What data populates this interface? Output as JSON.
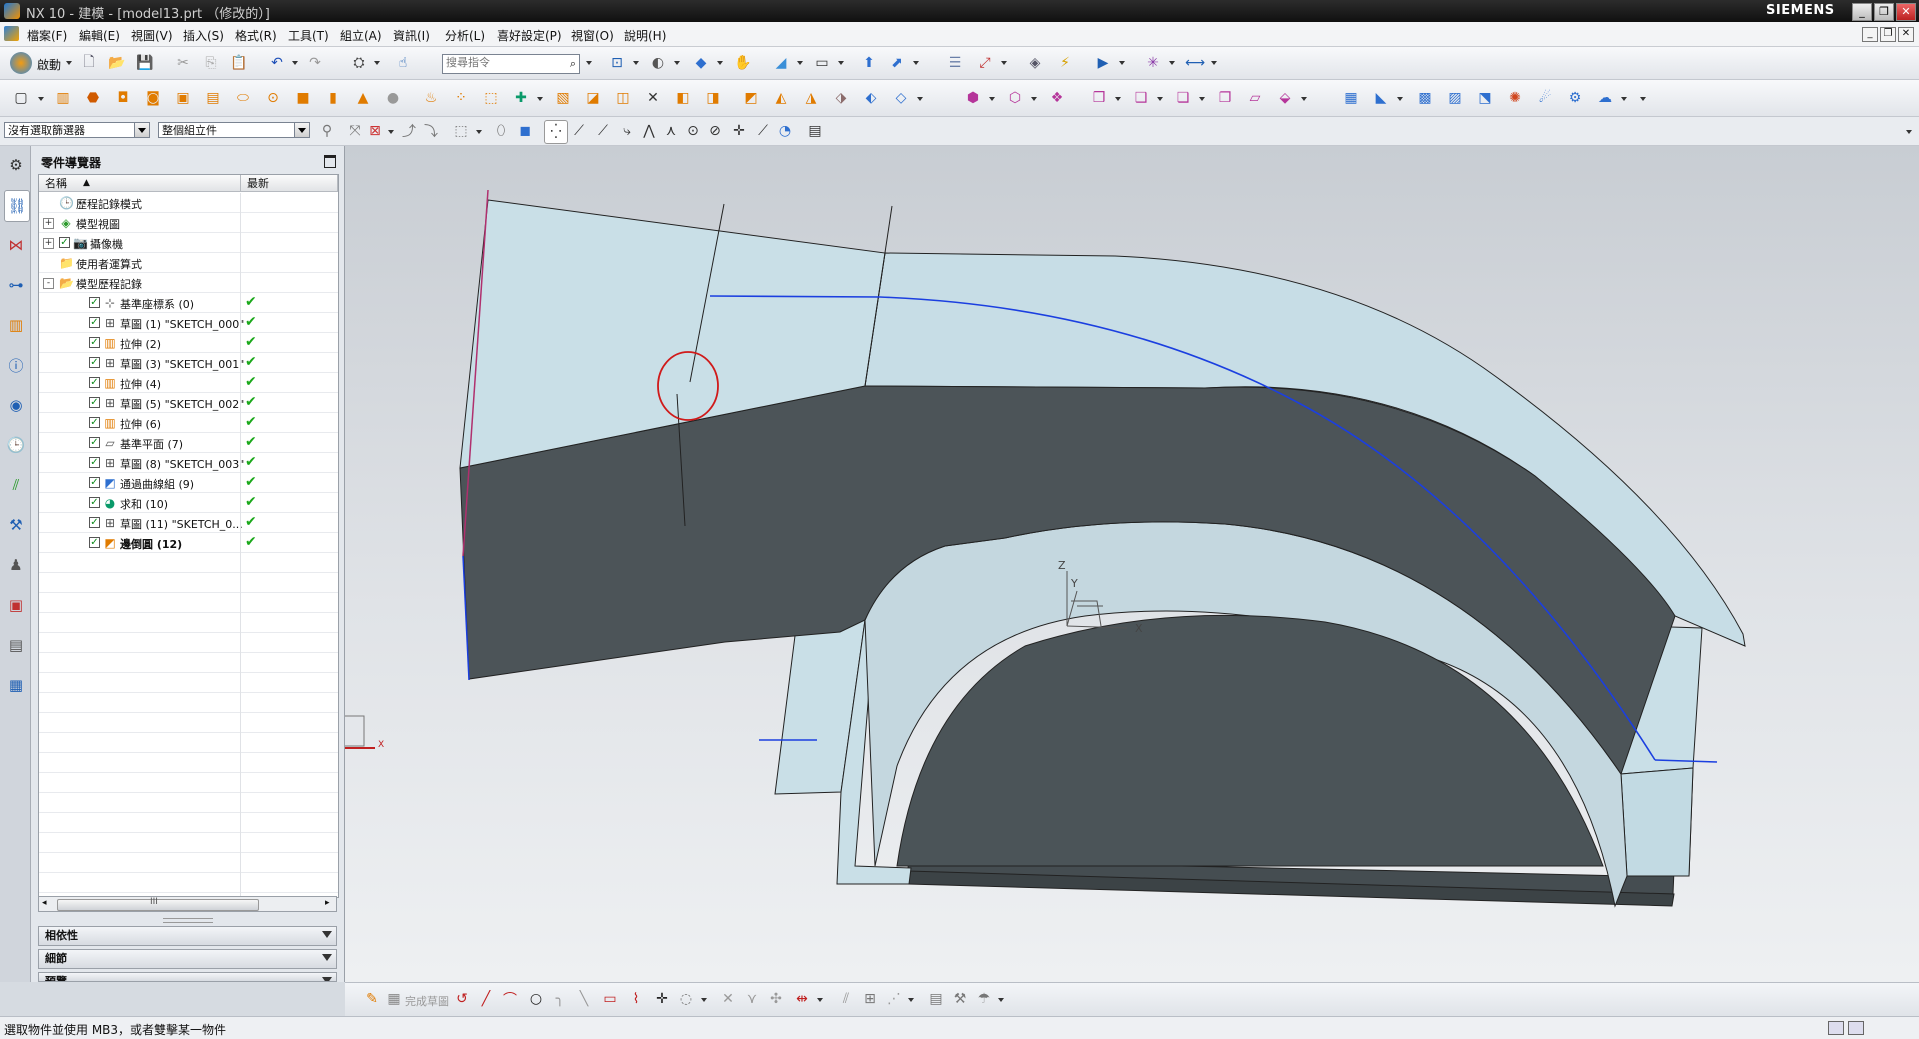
{
  "window": {
    "title": "NX 10 - 建模 - [model13.prt （修改的）]",
    "brand": "SIEMENS",
    "controls": [
      "_",
      "❐",
      "✕"
    ]
  },
  "menubar": {
    "items": [
      "檔案(F)",
      "編輯(E)",
      "視圖(V)",
      "插入(S)",
      "格式(R)",
      "工具(T)",
      "組立(A)",
      "資訊(I)",
      "分析(L)",
      "喜好設定(P)",
      "視窗(O)",
      "說明(H)"
    ]
  },
  "toolbar1": {
    "start_label": "啟動",
    "search_placeholder": "搜尋指令"
  },
  "selbar": {
    "filter_value": "沒有選取篩選器",
    "scope_value": "整個組立件"
  },
  "navigator": {
    "title": "零件導覽器",
    "col_name": "名稱",
    "col_latest": "最新",
    "rows": [
      {
        "label": "歷程記錄模式",
        "latest": ""
      },
      {
        "label": "模型視圖",
        "latest": ""
      },
      {
        "label": "攝像機",
        "latest": ""
      },
      {
        "label": "使用者運算式",
        "latest": ""
      },
      {
        "label": "模型歷程記錄",
        "latest": ""
      },
      {
        "label": "基準座標系 (0)",
        "latest": "✔"
      },
      {
        "label": "草圖 (1) \"SKETCH_000\"",
        "latest": "✔"
      },
      {
        "label": "拉伸 (2)",
        "latest": "✔"
      },
      {
        "label": "草圖 (3) \"SKETCH_001\"",
        "latest": "✔"
      },
      {
        "label": "拉伸 (4)",
        "latest": "✔"
      },
      {
        "label": "草圖 (5) \"SKETCH_002\"",
        "latest": "✔"
      },
      {
        "label": "拉伸 (6)",
        "latest": "✔"
      },
      {
        "label": "基準平面 (7)",
        "latest": "✔"
      },
      {
        "label": "草圖 (8) \"SKETCH_003\"",
        "latest": "✔"
      },
      {
        "label": "通過曲線組 (9)",
        "latest": "✔"
      },
      {
        "label": "求和 (10)",
        "latest": "✔"
      },
      {
        "label": "草圖 (11) \"SKETCH_0...",
        "latest": "✔"
      },
      {
        "label": "邊倒圓 (12)",
        "latest": "✔"
      }
    ],
    "scroll_grip": "III",
    "panels": [
      "相依性",
      "細節",
      "預覽"
    ]
  },
  "graphics": {
    "axis_x": "X",
    "axis_y": "Y",
    "axis_z": "Z"
  },
  "bottombar": {
    "finish_sketch_label": "完成草圖"
  },
  "status": {
    "message": "選取物件並使用 MB3，或者雙擊某一物件"
  },
  "colors": {
    "model_face_light": "#c8dde6",
    "model_face_dark": "#4a5357",
    "highlight_curve": "#1b3fe0",
    "annotation_circle": "#d01a1a"
  }
}
